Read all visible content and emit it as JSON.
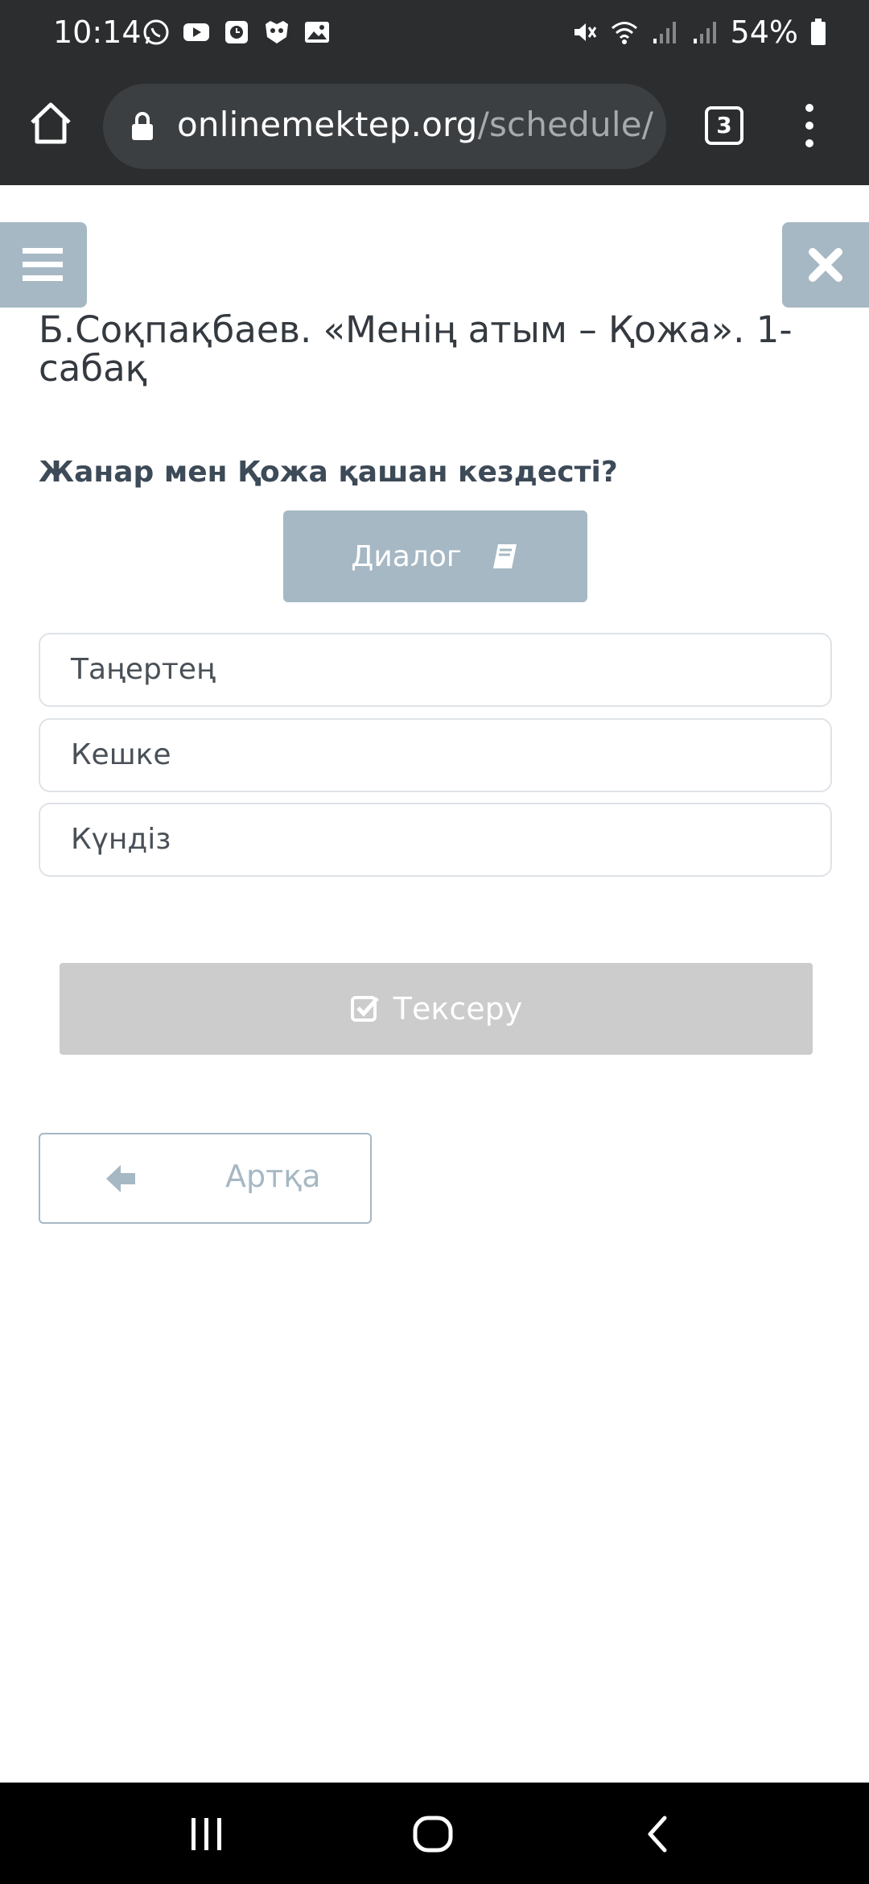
{
  "status_bar": {
    "time": "10:14",
    "battery": "54%",
    "left_icons": [
      "whatsapp-icon",
      "youtube-icon",
      "clock-app-icon",
      "mask-app-icon",
      "gallery-icon"
    ],
    "right_icons": [
      "mute-icon",
      "wifi-icon",
      "signal-icon",
      "signal-icon",
      "battery-icon"
    ]
  },
  "browser": {
    "url_host": "onlinemektep.org",
    "url_path": "/schedule/",
    "tab_count": "3"
  },
  "page": {
    "lesson_title": "Б.Соқпақбаев. «Менің атым – Қожа». 1-сабақ",
    "question": "Жанар мен Қожа қашан кездесті?",
    "dialog_label": "Диалог",
    "options": [
      "Таңертең",
      "Кешке",
      "Күндіз"
    ],
    "check_label": "Тексеру",
    "back_label": "Артқа"
  },
  "colors": {
    "accent": "#a6b8c4",
    "disabled": "#cccccc",
    "chrome_bar": "#2b2d2f"
  }
}
